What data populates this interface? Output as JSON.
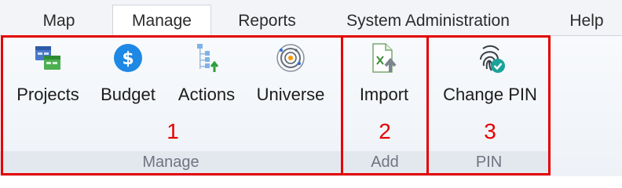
{
  "tabs": [
    {
      "label": "Map"
    },
    {
      "label": "Manage"
    },
    {
      "label": "Reports"
    },
    {
      "label": "System Administration"
    },
    {
      "label": "Help"
    }
  ],
  "groups": {
    "manage": {
      "label": "Manage",
      "number": "1",
      "buttons": [
        {
          "label": "Projects",
          "icon": "projects-icon"
        },
        {
          "label": "Budget",
          "icon": "dollar-icon"
        },
        {
          "label": "Actions",
          "icon": "hierarchy-icon"
        },
        {
          "label": "Universe",
          "icon": "universe-icon"
        }
      ]
    },
    "add": {
      "label": "Add",
      "number": "2",
      "buttons": [
        {
          "label": "Import",
          "icon": "import-icon"
        }
      ]
    },
    "pin": {
      "label": "PIN",
      "number": "3",
      "buttons": [
        {
          "label": "Change PIN",
          "icon": "fingerprint-icon"
        }
      ]
    }
  },
  "colors": {
    "highlight": "#e30000",
    "accent": "#1e88e5",
    "success": "#1aa39a"
  }
}
